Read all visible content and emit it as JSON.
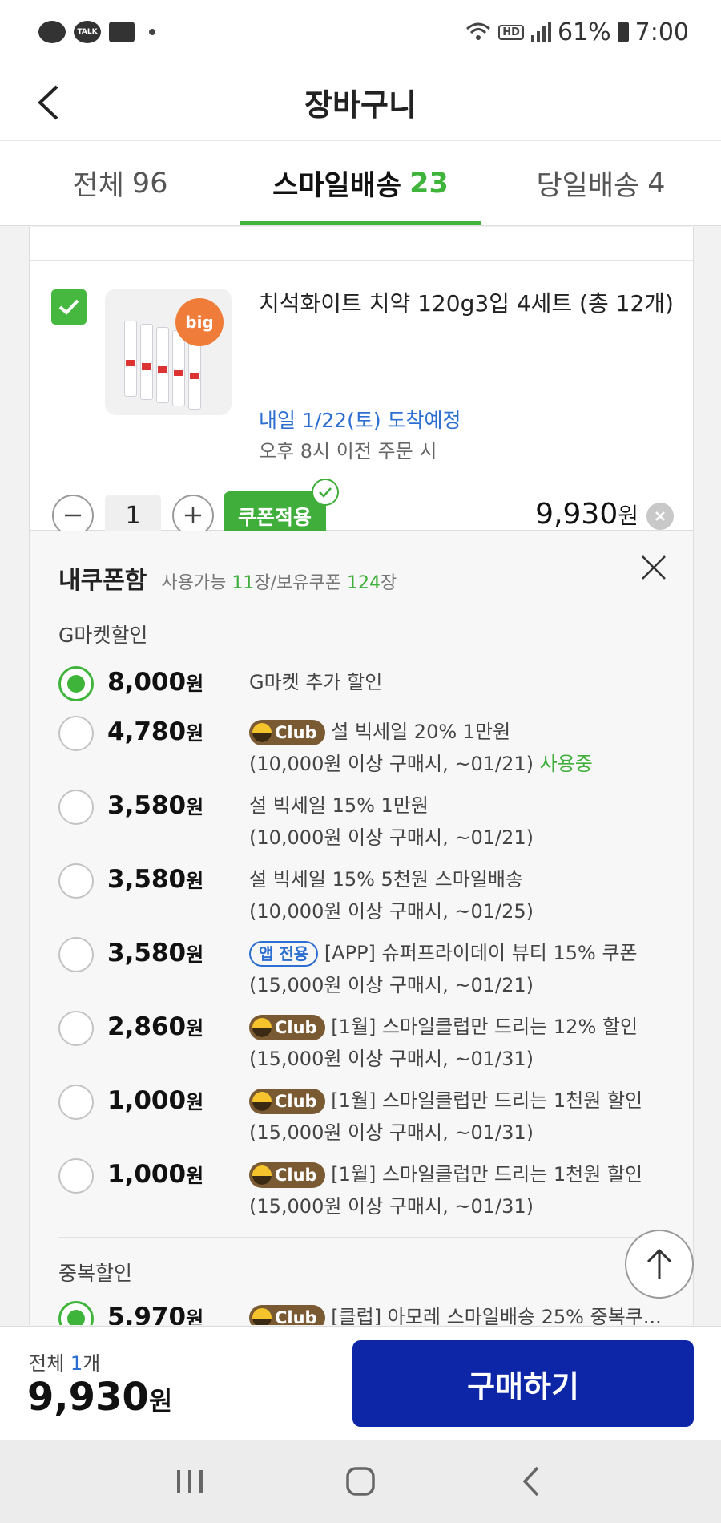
{
  "status_bar": {
    "left_icons": [
      "chat-bubble-icon",
      "talk-icon",
      "photo-icon"
    ],
    "talk_label": "TALK",
    "battery": "61%",
    "time": "7:00",
    "hd_label": "HD"
  },
  "header": {
    "title": "장바구니"
  },
  "tabs": [
    {
      "label": "전체",
      "count": "96"
    },
    {
      "label": "스마일배송",
      "count": "23"
    },
    {
      "label": "당일배송",
      "count": "4"
    }
  ],
  "item": {
    "checked": true,
    "badge": "big",
    "name": "치석화이트 치약 120g3입 4세트 (총 12개)",
    "delivery": "내일 1/22(토) 도착예정",
    "order_note": "오후 8시 이전 주문 시",
    "quantity": "1",
    "coupon_button": "쿠폰적용",
    "price": "9,930",
    "currency": "원"
  },
  "coupon_box": {
    "title": "내쿠폰함",
    "available_label": "사용가능",
    "available_count": "11",
    "unit": "장",
    "owned_label": "/보유쿠폰",
    "owned_count": "124",
    "section1": "G마켓할인",
    "options": [
      {
        "amount": "8,000",
        "selected": true,
        "badge": "",
        "title": "G마켓 추가 할인",
        "cond": "",
        "status": ""
      },
      {
        "amount": "4,780",
        "selected": false,
        "badge": "Club",
        "title": "설 빅세일 20% 1만원",
        "cond": "(10,000원 이상 구매시, ~01/21)",
        "status": "사용중"
      },
      {
        "amount": "3,580",
        "selected": false,
        "badge": "",
        "title": "설 빅세일 15% 1만원",
        "cond": "(10,000원 이상 구매시, ~01/21)",
        "status": ""
      },
      {
        "amount": "3,580",
        "selected": false,
        "badge": "",
        "title": "설 빅세일 15% 5천원 스마일배송",
        "cond": "(10,000원 이상 구매시, ~01/25)",
        "status": ""
      },
      {
        "amount": "3,580",
        "selected": false,
        "badge": "앱 전용",
        "title": "[APP] 슈퍼프라이데이 뷰티 15% 쿠폰",
        "cond": "(15,000원 이상 구매시, ~01/21)",
        "status": ""
      },
      {
        "amount": "2,860",
        "selected": false,
        "badge": "Club",
        "title": "[1월] 스마일클럽만 드리는 12% 할인",
        "cond": "(15,000원 이상 구매시, ~01/31)",
        "status": ""
      },
      {
        "amount": "1,000",
        "selected": false,
        "badge": "Club",
        "title": "[1월] 스마일클럽만 드리는 1천원 할인",
        "cond": "(15,000원 이상 구매시, ~01/31)",
        "status": ""
      },
      {
        "amount": "1,000",
        "selected": false,
        "badge": "Club",
        "title": "[1월] 스마일클럽만 드리는 1천원 할인",
        "cond": "(15,000원 이상 구매시, ~01/31)",
        "status": ""
      }
    ],
    "section2": "중복할인",
    "dup_option": {
      "amount": "5,970",
      "selected": true,
      "badge": "Club",
      "title": "[클럽] 아모레 스마일배송 25% 중복쿠..."
    }
  },
  "bottom": {
    "total_label": "전체",
    "total_count": "1",
    "count_unit": "개",
    "total_price": "9,930",
    "currency": "원",
    "buy_label": "구매하기"
  },
  "colors": {
    "accent": "#3fb43a",
    "buy": "#0d26a8",
    "link": "#2c6fd1",
    "club": "#7a5a33"
  }
}
